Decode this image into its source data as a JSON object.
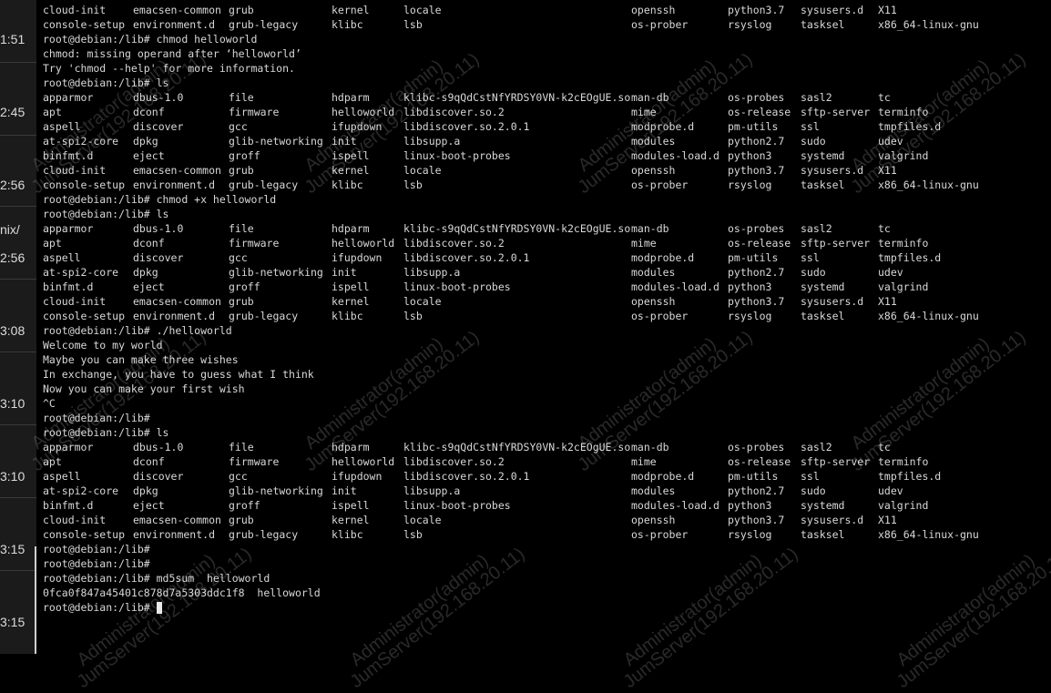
{
  "sidebar": {
    "times": [
      "1:51",
      "2:45",
      "2:56",
      "nix/",
      "2:56",
      "3:08",
      "3:10",
      "3:10",
      "3:15",
      "3:15"
    ]
  },
  "watermark": {
    "line1": "Administrator(admin)",
    "line2": "JumServer(192.168.20.11)"
  },
  "terminal": {
    "lines": [
      {
        "cells": [
          "cloud-init",
          "emacsen-common",
          "grub",
          "kernel",
          "locale",
          "",
          "openssh",
          "python3.7",
          "sysusers.d",
          "X11"
        ]
      },
      {
        "cells": [
          "console-setup",
          "environment.d",
          "grub-legacy",
          "klibc",
          "lsb",
          "",
          "os-prober",
          "rsyslog",
          "tasksel",
          "x86_64-linux-gnu"
        ]
      },
      {
        "text": "root@debian:/lib# chmod helloworld"
      },
      {
        "text": "chmod: missing operand after ‘helloworld’"
      },
      {
        "text": "Try 'chmod --help' for more information."
      },
      {
        "text": "root@debian:/lib# ls"
      },
      {
        "cells": [
          "apparmor",
          "dbus-1.0",
          "file",
          "hdparm",
          "klibc-s9qQdCstNfYRDSY0VN-k2cEOgUE.so",
          "man-db",
          "os-probes",
          "sasl2",
          "tc"
        ]
      },
      {
        "cells": [
          "apt",
          "dconf",
          "firmware",
          "helloworld",
          "libdiscover.so.2",
          "mime",
          "os-release",
          "sftp-server",
          "terminfo"
        ]
      },
      {
        "cells": [
          "aspell",
          "discover",
          "gcc",
          "ifupdown",
          "libdiscover.so.2.0.1",
          "modprobe.d",
          "pm-utils",
          "ssl",
          "tmpfiles.d"
        ]
      },
      {
        "cells": [
          "at-spi2-core",
          "dpkg",
          "glib-networking",
          "init",
          "libsupp.a",
          "modules",
          "python2.7",
          "sudo",
          "udev"
        ]
      },
      {
        "cells": [
          "binfmt.d",
          "eject",
          "groff",
          "ispell",
          "linux-boot-probes",
          "modules-load.d",
          "python3",
          "systemd",
          "valgrind"
        ]
      },
      {
        "cells": [
          "cloud-init",
          "emacsen-common",
          "grub",
          "kernel",
          "locale",
          "openssh",
          "python3.7",
          "sysusers.d",
          "X11"
        ]
      },
      {
        "cells": [
          "console-setup",
          "environment.d",
          "grub-legacy",
          "klibc",
          "lsb",
          "os-prober",
          "rsyslog",
          "tasksel",
          "x86_64-linux-gnu"
        ]
      },
      {
        "text": "root@debian:/lib# chmod +x helloworld"
      },
      {
        "text": "root@debian:/lib# ls"
      },
      {
        "cells": [
          "apparmor",
          "dbus-1.0",
          "file",
          "hdparm",
          "klibc-s9qQdCstNfYRDSY0VN-k2cEOgUE.so",
          "man-db",
          "os-probes",
          "sasl2",
          "tc"
        ]
      },
      {
        "cells": [
          "apt",
          "dconf",
          "firmware",
          "helloworld",
          "libdiscover.so.2",
          "mime",
          "os-release",
          "sftp-server",
          "terminfo"
        ]
      },
      {
        "cells": [
          "aspell",
          "discover",
          "gcc",
          "ifupdown",
          "libdiscover.so.2.0.1",
          "modprobe.d",
          "pm-utils",
          "ssl",
          "tmpfiles.d"
        ]
      },
      {
        "cells": [
          "at-spi2-core",
          "dpkg",
          "glib-networking",
          "init",
          "libsupp.a",
          "modules",
          "python2.7",
          "sudo",
          "udev"
        ]
      },
      {
        "cells": [
          "binfmt.d",
          "eject",
          "groff",
          "ispell",
          "linux-boot-probes",
          "modules-load.d",
          "python3",
          "systemd",
          "valgrind"
        ]
      },
      {
        "cells": [
          "cloud-init",
          "emacsen-common",
          "grub",
          "kernel",
          "locale",
          "openssh",
          "python3.7",
          "sysusers.d",
          "X11"
        ]
      },
      {
        "cells": [
          "console-setup",
          "environment.d",
          "grub-legacy",
          "klibc",
          "lsb",
          "os-prober",
          "rsyslog",
          "tasksel",
          "x86_64-linux-gnu"
        ]
      },
      {
        "text": "root@debian:/lib# ./helloworld"
      },
      {
        "text": "Welcome to my world"
      },
      {
        "text": "Maybe you can make three wishes"
      },
      {
        "text": "In exchange, you have to guess what I think"
      },
      {
        "text": "Now you can make your first wish"
      },
      {
        "text": "^C"
      },
      {
        "text": "root@debian:/lib#"
      },
      {
        "text": "root@debian:/lib# ls"
      },
      {
        "cells": [
          "apparmor",
          "dbus-1.0",
          "file",
          "hdparm",
          "klibc-s9qQdCstNfYRDSY0VN-k2cEOgUE.so",
          "man-db",
          "os-probes",
          "sasl2",
          "tc"
        ]
      },
      {
        "cells": [
          "apt",
          "dconf",
          "firmware",
          "helloworld",
          "libdiscover.so.2",
          "mime",
          "os-release",
          "sftp-server",
          "terminfo"
        ]
      },
      {
        "cells": [
          "aspell",
          "discover",
          "gcc",
          "ifupdown",
          "libdiscover.so.2.0.1",
          "modprobe.d",
          "pm-utils",
          "ssl",
          "tmpfiles.d"
        ]
      },
      {
        "cells": [
          "at-spi2-core",
          "dpkg",
          "glib-networking",
          "init",
          "libsupp.a",
          "modules",
          "python2.7",
          "sudo",
          "udev"
        ]
      },
      {
        "cells": [
          "binfmt.d",
          "eject",
          "groff",
          "ispell",
          "linux-boot-probes",
          "modules-load.d",
          "python3",
          "systemd",
          "valgrind"
        ]
      },
      {
        "cells": [
          "cloud-init",
          "emacsen-common",
          "grub",
          "kernel",
          "locale",
          "openssh",
          "python3.7",
          "sysusers.d",
          "X11"
        ]
      },
      {
        "cells": [
          "console-setup",
          "environment.d",
          "grub-legacy",
          "klibc",
          "lsb",
          "os-prober",
          "rsyslog",
          "tasksel",
          "x86_64-linux-gnu"
        ]
      },
      {
        "text": "root@debian:/lib#"
      },
      {
        "text": "root@debian:/lib#"
      },
      {
        "text": "root@debian:/lib# md5sum  helloworld"
      },
      {
        "text": "0fca0f847a45401c878d7a5303ddc1f8  helloworld"
      },
      {
        "text": "root@debian:/lib# "
      }
    ]
  }
}
